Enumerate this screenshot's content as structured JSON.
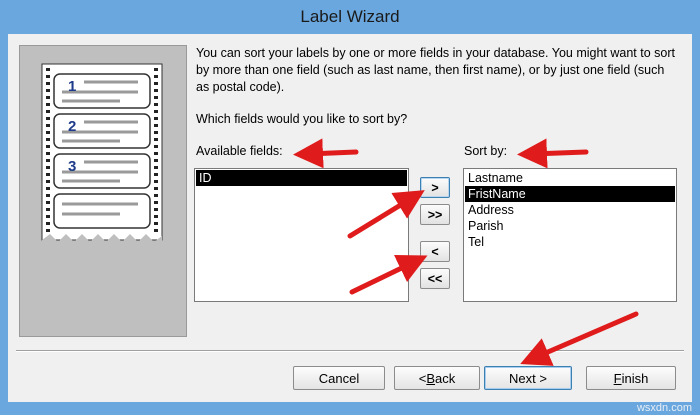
{
  "window": {
    "title": "Label Wizard"
  },
  "content": {
    "intro": "You can sort your labels by one or more fields in your database.  You might want to sort by more than one field (such as last name, then first name), or by just one field (such as postal code).",
    "question": "Which fields would you like to sort by?",
    "available_label": "Available fields:",
    "sort_label": "Sort by:",
    "available_fields": [
      {
        "label": "ID",
        "selected": true
      }
    ],
    "sort_fields": [
      {
        "label": "Lastname",
        "selected": false
      },
      {
        "label": "FristName",
        "selected": true
      },
      {
        "label": "Address",
        "selected": false
      },
      {
        "label": "Parish",
        "selected": false
      },
      {
        "label": "Tel",
        "selected": false
      }
    ]
  },
  "move_buttons": {
    "add": ">",
    "add_all": ">>",
    "remove": "<",
    "remove_all": "<<"
  },
  "footer": {
    "cancel": "Cancel",
    "back": {
      "mnemonic": "B",
      "rest": "ack",
      "prefix": "< "
    },
    "next": "Next >",
    "finish": {
      "mnemonic": "F",
      "rest": "inish"
    }
  },
  "illustration": {
    "labels": [
      "1",
      "2",
      "3"
    ]
  },
  "watermark": "wsxdn.com",
  "colors": {
    "title_bar": "#6aa7de",
    "dialog_bg": "#f0f0f0",
    "annotation_arrow": "#e01b1b",
    "selection": "#000000"
  }
}
